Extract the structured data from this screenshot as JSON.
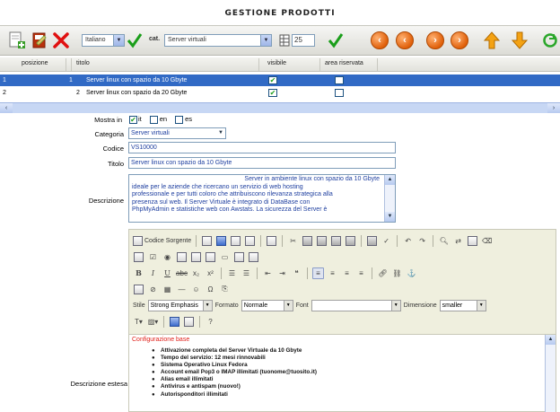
{
  "page_title": "GESTIONE PRODOTTI",
  "toolbar": {
    "language_select": "Italiano",
    "cat_label": "cat.",
    "category_select": "Server virtuali",
    "page_size": "25",
    "icons": [
      "add-icon",
      "edit-icon",
      "delete-icon",
      "confirm-icon",
      "first-page-icon",
      "prev-page-icon",
      "next-page-icon",
      "last-page-icon",
      "move-up-icon",
      "move-down-icon",
      "refresh-icon"
    ]
  },
  "grid": {
    "columns": [
      "posizione",
      "titolo",
      "visibile",
      "area riservata"
    ],
    "rows": [
      {
        "index": "1",
        "posizione": "1",
        "titolo": "Server linux con spazio da 10 Gbyte",
        "visibile": true,
        "area_riservata": false
      },
      {
        "index": "2",
        "posizione": "2",
        "titolo": "Server linux con spazio da 20 Gbyte",
        "visibile": true,
        "area_riservata": false
      }
    ]
  },
  "form": {
    "mostra_in_label": "Mostra in",
    "languages": [
      {
        "code": "it",
        "checked": true
      },
      {
        "code": "en",
        "checked": false
      },
      {
        "code": "es",
        "checked": false
      }
    ],
    "categoria_label": "Categoria",
    "categoria_value": "Server virtuali",
    "codice_label": "Codice",
    "codice_value": "VS10000",
    "titolo_label": "Titolo",
    "titolo_value": "Server linux con spazio da 10 Gbyte",
    "descrizione_label": "Descrizione",
    "descrizione_lines": [
      "Server in ambiente linux con spazio da 10 Gbyte",
      "ideale per le aziende che ricercano un servizio di web hosting",
      "professionale e per tutti coloro che attribuiscono rilevanza strategica alla",
      "presenza sul web. Il Server Virtuale è integrato di DataBase con",
      "PhpMyAdmin e statistiche web con Awstats. La sicurezza del Server è"
    ],
    "descrizione_estesa_label": "Descrizione estesa"
  },
  "editor": {
    "source_label": "Codice Sorgente",
    "stile_label": "Stile",
    "stile_value": "Strong Emphasis",
    "formato_label": "Formato",
    "formato_value": "Normale",
    "font_label": "Font",
    "font_value": "",
    "dimensione_label": "Dimensione",
    "dimensione_value": "smaller",
    "content_heading": "Configurazione base",
    "bullets": [
      "Attivazione completa del Server Virtuale da 10 Gbyte",
      "Tempo del servizio: 12 mesi rinnovabili",
      "Sistema Operativo Linux Fedora",
      "Account email Pop3 o IMAP illimitati (tuonome@tuosito.it)",
      "Alias email illimitati",
      "Antivirus e antispam (nuovo!)",
      "Autorisponditori illimitati"
    ]
  }
}
